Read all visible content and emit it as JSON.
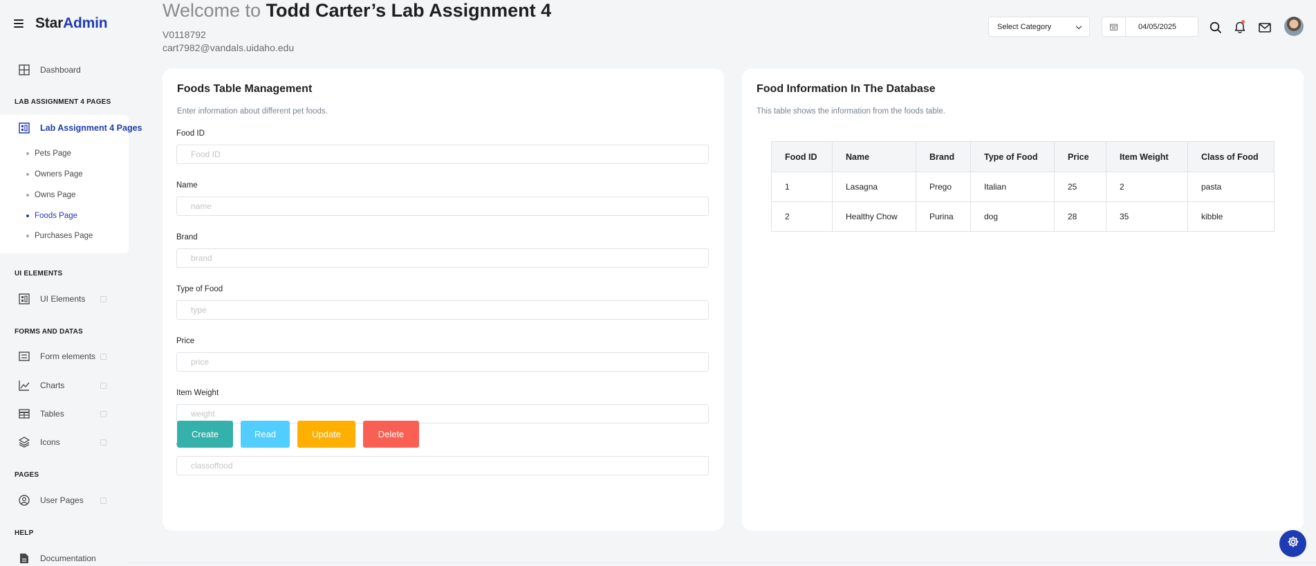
{
  "brand": {
    "star": "Star",
    "admin": "Admin"
  },
  "sidebar": {
    "dashboard": "Dashboard",
    "sections": {
      "lab": "LAB ASSIGNMENT 4 PAGES",
      "ui": "UI ELEMENTS",
      "forms": "FORMS AND DATAS",
      "pages": "PAGES",
      "help": "HELP"
    },
    "lab_item": "Lab Assignment 4 Pages",
    "sub_items": [
      {
        "label": "Pets Page"
      },
      {
        "label": "Owners Page"
      },
      {
        "label": "Owns Page"
      },
      {
        "label": "Foods Page"
      },
      {
        "label": "Purchases Page"
      }
    ],
    "ui_elements": "UI Elements",
    "form_elements": "Form elements",
    "charts": "Charts",
    "tables": "Tables",
    "icons": "Icons",
    "user_pages": "User Pages",
    "documentation": "Documentation"
  },
  "header": {
    "welcome_prefix": "Welcome to ",
    "welcome_name": "Todd Carter’s Lab Assignment 4",
    "student_id": "V0118792",
    "email": "cart7982@vandals.uidaho.edu",
    "category_select": "Select Category",
    "date": "04/05/2025"
  },
  "form_card": {
    "title": "Foods Table Management",
    "description": "Enter information about different pet foods.",
    "fields": [
      {
        "label": "Food ID",
        "placeholder": "Food ID"
      },
      {
        "label": "Name",
        "placeholder": "name"
      },
      {
        "label": "Brand",
        "placeholder": "brand"
      },
      {
        "label": "Type of Food",
        "placeholder": "type"
      },
      {
        "label": "Price",
        "placeholder": "price"
      },
      {
        "label": "Item Weight",
        "placeholder": "weight"
      },
      {
        "label": "Class of Food",
        "placeholder": "classoffood"
      }
    ],
    "buttons": {
      "create": "Create",
      "read": "Read",
      "update": "Update",
      "delete": "Delete"
    }
  },
  "table_card": {
    "title": "Food Information In The Database",
    "description": "This table shows the information from the foods table.",
    "columns": [
      "Food ID",
      "Name",
      "Brand",
      "Type of Food",
      "Price",
      "Item Weight",
      "Class of Food"
    ],
    "rows": [
      [
        "1",
        "Lasagna",
        "Prego",
        "Italian",
        "25",
        "2",
        "pasta"
      ],
      [
        "2",
        "Healthy Chow",
        "Purina",
        "dog",
        "28",
        "35",
        "kibble"
      ]
    ]
  },
  "colors": {
    "accent": "#1f3bb3",
    "create": "#34b1aa",
    "read": "#52cdff",
    "update": "#ffaf00",
    "delete": "#f95f53"
  }
}
